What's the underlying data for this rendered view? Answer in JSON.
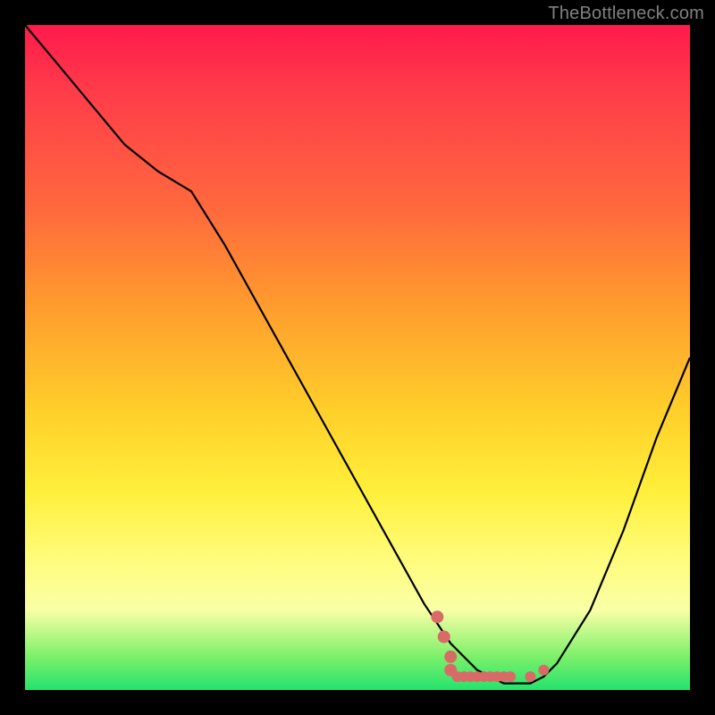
{
  "watermark": "TheBottleneck.com",
  "colors": {
    "background": "#000000",
    "curve": "#000000",
    "marker": "#d86a68",
    "gradient_top": "#ff1a4c",
    "gradient_mid": "#ffef3a",
    "gradient_bottom": "#24e36e"
  },
  "chart_data": {
    "type": "line",
    "title": "",
    "xlabel": "",
    "ylabel": "",
    "xlim": [
      0,
      100
    ],
    "ylim": [
      0,
      100
    ],
    "grid": false,
    "legend": false,
    "x": [
      0,
      5,
      10,
      15,
      20,
      25,
      30,
      35,
      40,
      45,
      50,
      55,
      60,
      62,
      64,
      66,
      68,
      70,
      72,
      74,
      76,
      78,
      80,
      85,
      90,
      95,
      100
    ],
    "values": [
      100,
      94,
      88,
      82,
      78,
      75,
      67,
      58,
      49,
      40,
      31,
      22,
      13,
      10,
      7,
      5,
      3,
      2,
      1,
      1,
      1,
      2,
      4,
      12,
      24,
      38,
      50
    ],
    "markers": {
      "x": [
        62,
        63,
        64,
        64,
        65,
        66,
        67,
        68,
        69,
        70,
        71,
        72,
        73,
        76,
        78
      ],
      "values": [
        11,
        8,
        5,
        3,
        2,
        2,
        2,
        2,
        2,
        2,
        2,
        2,
        2,
        2,
        3
      ]
    }
  }
}
